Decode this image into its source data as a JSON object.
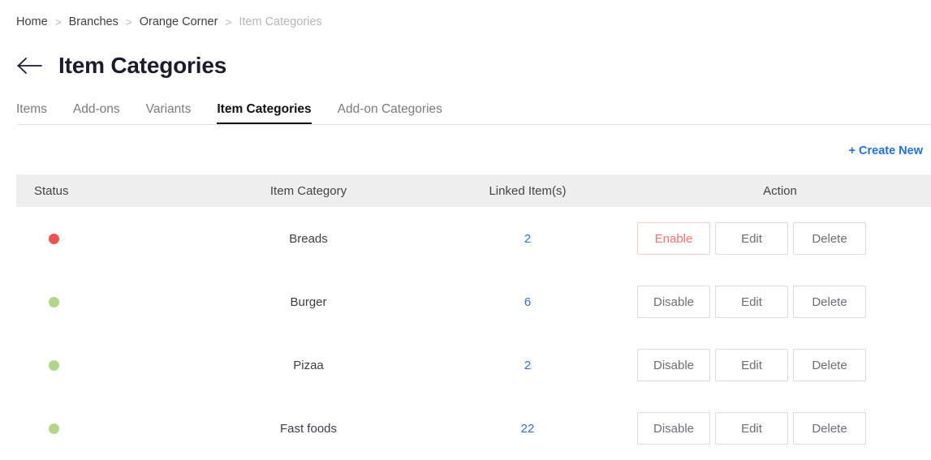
{
  "breadcrumb": {
    "separator": ">",
    "items": [
      {
        "label": "Home",
        "current": false
      },
      {
        "label": "Branches",
        "current": false
      },
      {
        "label": "Orange Corner",
        "current": false
      },
      {
        "label": "Item Categories",
        "current": true
      }
    ]
  },
  "header": {
    "back_icon": "arrow-left-icon",
    "title": "Item Categories"
  },
  "tabs": [
    {
      "label": "Items",
      "active": false
    },
    {
      "label": "Add-ons",
      "active": false
    },
    {
      "label": "Variants",
      "active": false
    },
    {
      "label": "Item Categories",
      "active": true
    },
    {
      "label": "Add-on Categories",
      "active": false
    }
  ],
  "toolbar": {
    "create_new_label": "+ Create New"
  },
  "table": {
    "columns": {
      "status": "Status",
      "category": "Item Category",
      "linked": "Linked Item(s)",
      "action": "Action"
    },
    "rows": [
      {
        "status": "inactive",
        "category": "Breads",
        "linked": "2",
        "toggle_label": "Enable",
        "edit_label": "Edit",
        "delete_label": "Delete"
      },
      {
        "status": "active",
        "category": "Burger",
        "linked": "6",
        "toggle_label": "Disable",
        "edit_label": "Edit",
        "delete_label": "Delete"
      },
      {
        "status": "active",
        "category": "Pizaa",
        "linked": "2",
        "toggle_label": "Disable",
        "edit_label": "Edit",
        "delete_label": "Delete"
      },
      {
        "status": "active",
        "category": "Fast foods",
        "linked": "22",
        "toggle_label": "Disable",
        "edit_label": "Edit",
        "delete_label": "Delete"
      }
    ]
  },
  "colors": {
    "accent_link": "#1f6fec",
    "status_active": "#b0d68a",
    "status_inactive": "#ef5350",
    "enable_text": "#f4726c",
    "header_bg": "#eeeeee"
  }
}
